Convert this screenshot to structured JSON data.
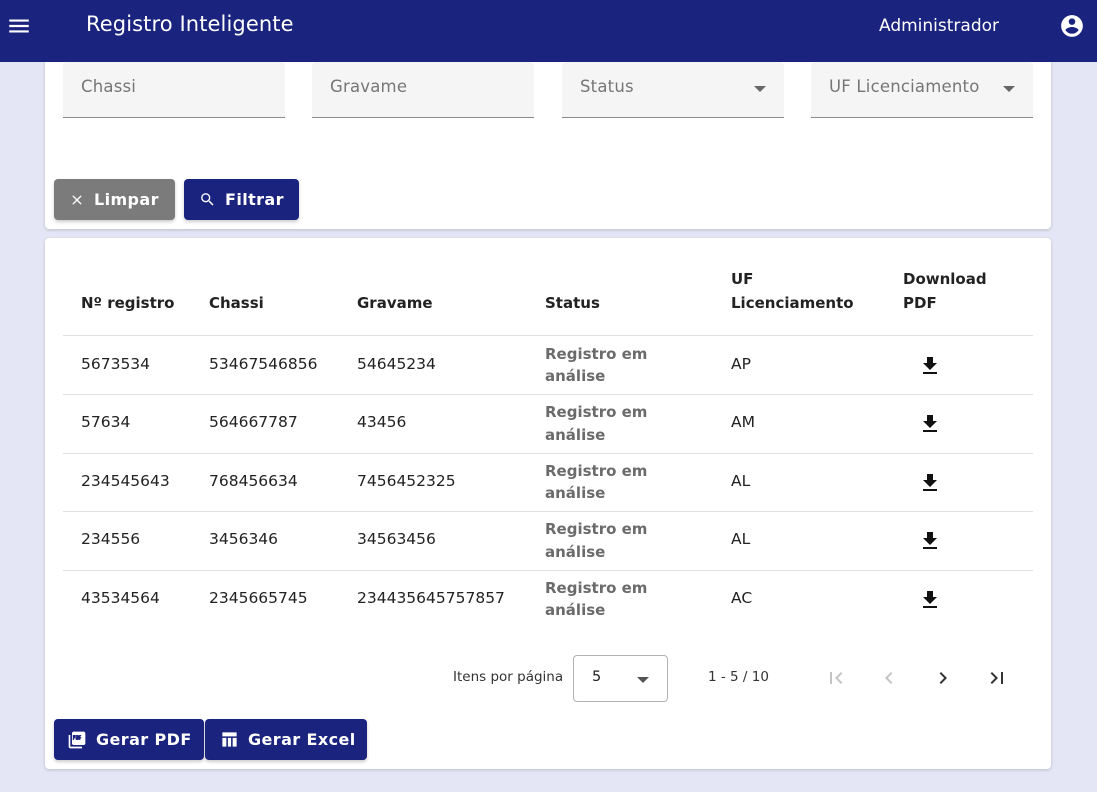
{
  "header": {
    "menu_icon": "menu-icon",
    "title": "Registro Inteligente",
    "user": "Administrador",
    "account_icon": "account-circle-icon",
    "color": "#1a237e"
  },
  "filters": {
    "chassi_placeholder": "Chassi",
    "gravame_placeholder": "Gravame",
    "status_placeholder": "Status",
    "uf_placeholder": "UF Licenciamento",
    "clear_label": "Limpar",
    "filter_label": "Filtrar"
  },
  "table": {
    "headers": {
      "registro": "Nº registro",
      "chassi": "Chassi",
      "gravame": "Gravame",
      "status": "Status",
      "uf_line1": "UF",
      "uf_line2": "Licenciamento",
      "download_line1": "Download",
      "download_line2": "PDF"
    },
    "rows": [
      {
        "registro": "5673534",
        "chassi": "53467546856",
        "gravame": "54645234",
        "status": "Registro em análise",
        "uf": "AP"
      },
      {
        "registro": "57634",
        "chassi": "564667787",
        "gravame": "43456",
        "status": "Registro em análise",
        "uf": "AM"
      },
      {
        "registro": "234545643",
        "chassi": "768456634",
        "gravame": "7456452325",
        "status": "Registro em análise",
        "uf": "AL"
      },
      {
        "registro": "234556",
        "chassi": "3456346",
        "gravame": "34563456",
        "status": "Registro em análise",
        "uf": "AL"
      },
      {
        "registro": "43534564",
        "chassi": "2345665745",
        "gravame": "234435645757857",
        "status": "Registro em análise",
        "uf": "AC"
      }
    ]
  },
  "paginator": {
    "items_label": "Itens por página",
    "page_size": "5",
    "range": "1 - 5 / 10"
  },
  "actions": {
    "pdf_label": "Gerar PDF",
    "excel_label": "Gerar Excel"
  }
}
